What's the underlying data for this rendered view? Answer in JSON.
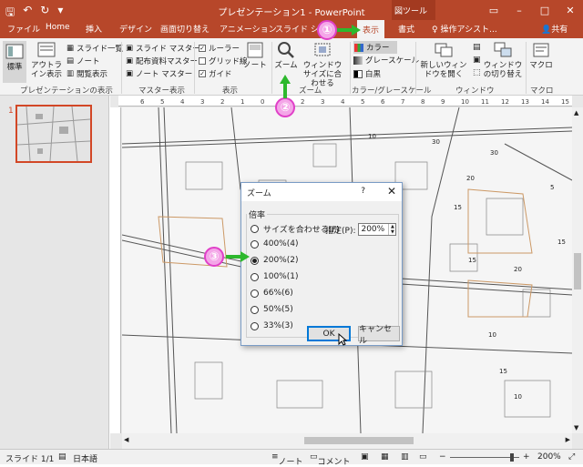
{
  "window": {
    "title": "プレゼンテーション1 - PowerPoint",
    "context_tab_group": "図ツール"
  },
  "tabs": [
    "ファイル",
    "Home",
    "挿入",
    "デザイン",
    "画面切り替え",
    "アニメーション",
    "スライド ショー",
    "表示",
    "書式"
  ],
  "tell_me": "操作アシスト...",
  "share": "共有",
  "ribbon": {
    "presentation_views": {
      "group_label": "プレゼンテーションの表示",
      "normal": "標準",
      "outline": "アウトライン表示",
      "slide_sorter": "スライド一覧",
      "notes_page": "ノート",
      "reading_view": "閲覧表示"
    },
    "master_views": {
      "group_label": "マスター表示",
      "slide_master": "スライド マスター",
      "handout_master": "配布資料マスター",
      "notes_master": "ノート マスター"
    },
    "show": {
      "group_label": "表示",
      "ruler": "ルーラー",
      "gridlines": "グリッド線",
      "guides": "ガイド",
      "notes": "ノート"
    },
    "zoom": {
      "group_label": "ズーム",
      "zoom": "ズーム",
      "fit_window": "ウィンドウ サイズに合わせる"
    },
    "color": {
      "group_label": "カラー/グレースケール",
      "color": "カラー",
      "grayscale": "グレースケール",
      "bw": "白黒"
    },
    "window": {
      "group_label": "ウィンドウ",
      "new_window": "新しいウィンドウを開く",
      "switch": "ウィンドウの切り替え"
    },
    "macro": {
      "group_label": "マクロ",
      "macro": "マクロ"
    }
  },
  "sidebar": {
    "slide_number": "1"
  },
  "map_labels": [
    "10",
    "30",
    "15",
    "15",
    "20",
    "10",
    "15",
    "20",
    "5",
    "15",
    "30",
    "10"
  ],
  "ruler_numbers": [
    "6",
    "5",
    "4",
    "3",
    "2",
    "1",
    "0",
    "1",
    "2",
    "3",
    "4",
    "5",
    "6",
    "7",
    "8",
    "9",
    "10",
    "11",
    "12",
    "13",
    "14",
    "15"
  ],
  "dialog": {
    "title": "ズーム",
    "help": "?",
    "close": "✕",
    "legend": "倍率",
    "options": [
      "サイズを合わせる(F)",
      "400%(4)",
      "200%(2)",
      "100%(1)",
      "66%(6)",
      "50%(5)",
      "33%(3)"
    ],
    "selected": "200%(2)",
    "spec_label": "指定(P):",
    "spec_value": "200%",
    "ok": "OK",
    "cancel": "キャンセル"
  },
  "callouts": [
    "①",
    "②",
    "③"
  ],
  "status": {
    "slide": "スライド 1/1",
    "language": "日本語",
    "notes": "ノート",
    "comments": "コメント",
    "zoom": "200%"
  },
  "colors": {
    "accent": "#b7472a",
    "callout": "#e040c8",
    "arrow": "#2db82d"
  }
}
